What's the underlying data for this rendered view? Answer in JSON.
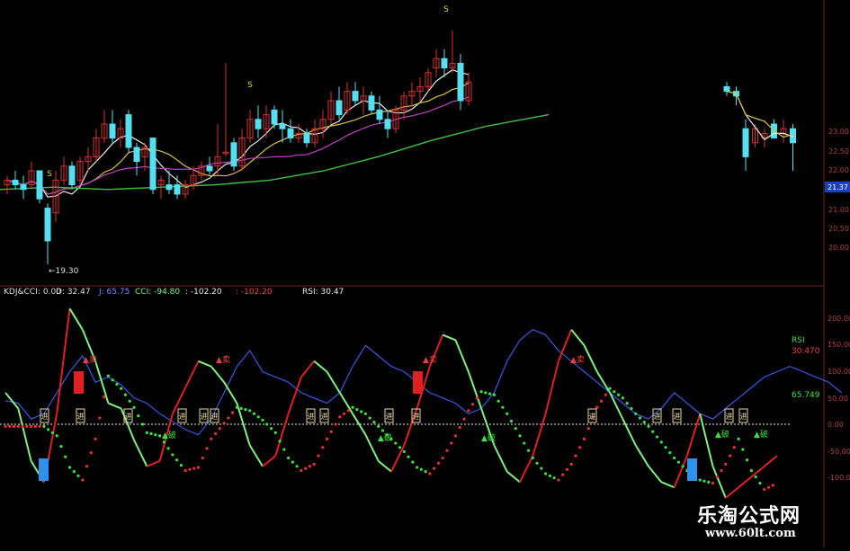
{
  "price_panel": {
    "low_label": "19.30",
    "signal_mark": "S",
    "y_ticks": [
      "23.00",
      "22.50",
      "22.00",
      "21.50",
      "21.00",
      "20.50",
      "20.00"
    ],
    "current_price": "21.37"
  },
  "indicator_header": {
    "name": "KDJ&CCI",
    "k": ": 0.00",
    "d": "D: 32.47",
    "j": "J: 65.75",
    "cci": "CCI: -94.80",
    "v1": ": -102.20",
    "v2": ": -102.20",
    "rsi": "RSI: 30.47"
  },
  "indicator_panel": {
    "y_ticks": [
      "200.00",
      "150.00",
      "100.00",
      "50.00",
      "0.00",
      "-50.00",
      "-100.00"
    ],
    "rsi_label": "RSI",
    "rsi_value": "30.470",
    "green_value": "65.749",
    "buy_tag": "买",
    "tag_glyph": "进",
    "sell_tag": "▲卖",
    "low_tag": "▲破"
  },
  "watermark": {
    "title": "乐淘公式网",
    "url": "www.60lt.com"
  },
  "colors": {
    "up_candle": "#d83030",
    "down_candle": "#54e0f0",
    "ma_white": "#e8e8e8",
    "ma_yellow": "#d8c040",
    "ma_magenta": "#c040c0",
    "ma_green": "#40c040",
    "line_red": "#e02020",
    "line_green": "#80f080",
    "line_blue": "#3858e0",
    "dot_red": "#f03030",
    "dot_green": "#40e040"
  },
  "chart_data": [
    {
      "type": "candlestick",
      "title": "",
      "ylim": [
        19.2,
        23.2
      ],
      "annotations": [
        "19.30",
        "21.37"
      ],
      "candles_ohlc": [
        [
          21.0,
          21.2,
          20.8,
          21.1
        ],
        [
          21.1,
          21.3,
          20.9,
          21.0
        ],
        [
          21.0,
          21.2,
          20.7,
          20.9
        ],
        [
          21.0,
          21.5,
          20.9,
          21.3
        ],
        [
          21.3,
          21.3,
          20.6,
          20.7
        ],
        [
          20.5,
          20.6,
          19.3,
          19.8
        ],
        [
          20.4,
          21.3,
          20.2,
          21.1
        ],
        [
          21.1,
          21.6,
          21.0,
          21.4
        ],
        [
          21.4,
          21.5,
          20.9,
          21.0
        ],
        [
          21.1,
          21.6,
          21.0,
          21.5
        ],
        [
          21.5,
          21.8,
          21.3,
          21.6
        ],
        [
          21.6,
          22.2,
          21.5,
          22.0
        ],
        [
          22.0,
          22.6,
          21.9,
          22.3
        ],
        [
          22.3,
          22.6,
          21.9,
          22.0
        ],
        [
          22.0,
          22.4,
          21.8,
          22.2
        ],
        [
          22.5,
          22.6,
          21.7,
          21.8
        ],
        [
          21.8,
          21.9,
          21.2,
          21.5
        ],
        [
          21.6,
          21.9,
          21.3,
          21.8
        ],
        [
          22.0,
          22.0,
          20.8,
          20.9
        ],
        [
          21.0,
          21.2,
          20.7,
          21.1
        ],
        [
          21.0,
          21.3,
          20.8,
          20.9
        ],
        [
          21.0,
          21.2,
          20.7,
          20.8
        ],
        [
          20.8,
          21.1,
          20.7,
          21.0
        ],
        [
          21.0,
          21.4,
          20.9,
          21.2
        ],
        [
          21.2,
          21.5,
          21.1,
          21.4
        ],
        [
          21.4,
          21.6,
          21.2,
          21.3
        ],
        [
          21.4,
          22.3,
          21.2,
          21.6
        ],
        [
          21.7,
          23.6,
          21.6,
          21.7
        ],
        [
          21.9,
          22.0,
          21.3,
          21.4
        ],
        [
          21.4,
          22.2,
          21.3,
          22.0
        ],
        [
          22.0,
          22.6,
          21.9,
          22.4
        ],
        [
          22.4,
          22.7,
          22.0,
          22.2
        ],
        [
          22.2,
          22.7,
          22.0,
          22.5
        ],
        [
          22.6,
          22.7,
          22.2,
          22.3
        ],
        [
          22.3,
          22.6,
          21.9,
          22.2
        ],
        [
          22.2,
          22.4,
          21.9,
          22.0
        ],
        [
          22.0,
          22.3,
          21.9,
          22.1
        ],
        [
          22.1,
          22.2,
          21.8,
          21.9
        ],
        [
          21.9,
          22.4,
          21.8,
          22.2
        ],
        [
          22.2,
          22.6,
          22.0,
          22.4
        ],
        [
          22.4,
          23.0,
          22.3,
          22.8
        ],
        [
          22.8,
          23.1,
          22.4,
          22.5
        ],
        [
          22.6,
          23.2,
          22.5,
          23.0
        ],
        [
          23.0,
          23.2,
          22.7,
          22.8
        ],
        [
          22.8,
          23.1,
          22.5,
          22.9
        ],
        [
          22.9,
          23.0,
          22.5,
          22.6
        ],
        [
          22.6,
          22.9,
          22.3,
          22.4
        ],
        [
          22.4,
          22.6,
          22.0,
          22.2
        ],
        [
          22.2,
          22.7,
          22.1,
          22.6
        ],
        [
          22.6,
          23.0,
          22.4,
          22.9
        ],
        [
          22.9,
          23.2,
          22.7,
          23.0
        ],
        [
          23.0,
          23.3,
          22.8,
          23.1
        ],
        [
          23.1,
          23.5,
          23.0,
          23.4
        ],
        [
          23.5,
          23.9,
          23.3,
          23.7
        ],
        [
          23.7,
          23.9,
          23.3,
          23.5
        ],
        [
          23.5,
          24.3,
          23.4,
          23.6
        ],
        [
          23.6,
          23.8,
          22.6,
          22.8
        ],
        [
          22.8,
          23.4,
          22.7,
          23.2
        ]
      ],
      "candles_right_ohlc": [
        [
          23.1,
          23.2,
          22.9,
          23.0
        ],
        [
          23.0,
          23.1,
          22.7,
          22.9
        ],
        [
          22.2,
          22.4,
          21.3,
          21.6
        ],
        [
          21.9,
          22.3,
          21.8,
          22.2
        ],
        [
          22.0,
          22.2,
          21.8,
          22.1
        ],
        [
          22.3,
          22.4,
          22.0,
          22.0
        ],
        [
          22.1,
          22.4,
          21.9,
          22.2
        ],
        [
          22.2,
          22.3,
          21.3,
          21.9
        ]
      ]
    },
    {
      "type": "line",
      "title": "KDJ&CCI",
      "ylim": [
        -150,
        240
      ],
      "series": [
        {
          "name": "RSI",
          "values": [
            45,
            40,
            10,
            20,
            60,
            100,
            130,
            80,
            90,
            75,
            50,
            40,
            20,
            5,
            -10,
            -20,
            10,
            60,
            110,
            140,
            100,
            90,
            80,
            60,
            50,
            40,
            60,
            110,
            150,
            130,
            110,
            100,
            80,
            60,
            50,
            40,
            20,
            30,
            60,
            120,
            160,
            180,
            170,
            140,
            120,
            100,
            80,
            60,
            40,
            20,
            10,
            30,
            60,
            40,
            20,
            10,
            30,
            50,
            70,
            90,
            100,
            110,
            100,
            90,
            80,
            60
          ]
        },
        {
          "name": "",
          "values": [
            60,
            30,
            -70,
            -110,
            20,
            220,
            180,
            120,
            40,
            30,
            -30,
            -80,
            -70,
            20,
            70,
            120,
            110,
            80,
            40,
            -40,
            -80,
            -60,
            20,
            90,
            120,
            100,
            60,
            20,
            -20,
            -70,
            -90,
            -40,
            30,
            110,
            170,
            160,
            100,
            30,
            -40,
            -90,
            -110,
            -60,
            20,
            120,
            180,
            150,
            100,
            60,
            10,
            -40,
            -80,
            -110,
            -120,
            -60,
            20,
            -80,
            -140,
            -120,
            -100,
            -80,
            -60
          ]
        }
      ]
    }
  ]
}
